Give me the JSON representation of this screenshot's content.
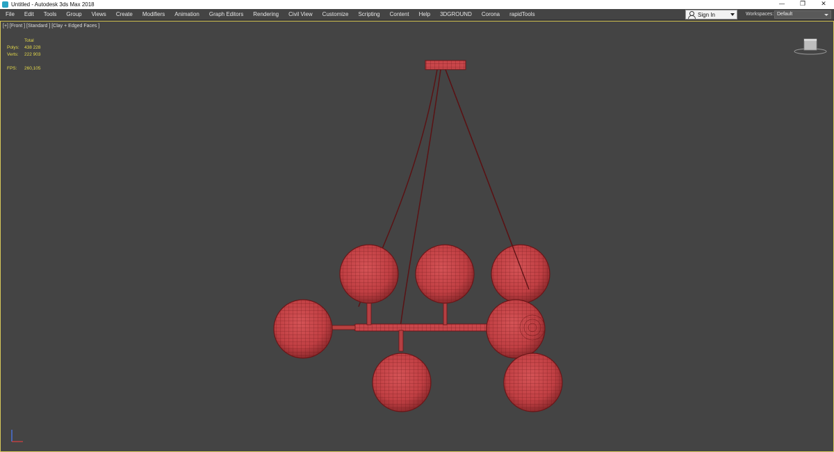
{
  "window": {
    "title": "Untitled - Autodesk 3ds Max 2018",
    "controls": [
      "—",
      "❐",
      "✕"
    ]
  },
  "menu": {
    "items": [
      "File",
      "Edit",
      "Tools",
      "Group",
      "Views",
      "Create",
      "Modifiers",
      "Animation",
      "Graph Editors",
      "Rendering",
      "Civil View",
      "Customize",
      "Scripting",
      "Content",
      "Help",
      "3DGROUND",
      "Corona",
      "rapidTools"
    ],
    "sign_in": "Sign In",
    "workspaces_label": "Workspaces:",
    "workspaces_value": "Default"
  },
  "viewport": {
    "label": "[+] [Front ] [Standard ] [Clay + Edged Faces ]",
    "stats": {
      "header": "Total",
      "polys_label": "Polys:",
      "polys_value": "438 228",
      "verts_label": "Verts:",
      "verts_value": "222 903",
      "fps_label": "FPS:",
      "fps_value": "260,105"
    }
  },
  "colors": {
    "viewport_bg": "#444444",
    "model_fill": "#c9464a",
    "wire": "#6a1618",
    "stats_text": "#e4d84a",
    "viewport_border": "#d9c85a"
  }
}
